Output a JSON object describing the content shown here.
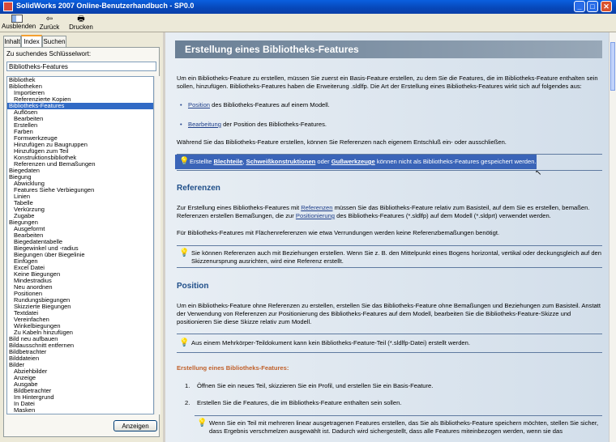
{
  "window": {
    "title": "SolidWorks 2007 Online-Benutzerhandbuch - SP0.0",
    "min": "_",
    "max": "□",
    "close": "✕"
  },
  "toolbar": {
    "hide": "Ausblenden",
    "back": "Zurück",
    "print": "Drucken"
  },
  "tabs": [
    "Inhalt",
    "Index",
    "Suchen"
  ],
  "index": {
    "label": "Zu suchendes Schlüsselwort:",
    "value": "Bibliotheks-Features",
    "items": [
      {
        "t": "Bibliothek",
        "l": 0
      },
      {
        "t": "Bibliotheken",
        "l": 0
      },
      {
        "t": "Importieren",
        "l": 1
      },
      {
        "t": "Referenzierte Kopien",
        "l": 1
      },
      {
        "t": "Bibliotheks-Features",
        "l": 0,
        "sel": true
      },
      {
        "t": "Auflösen",
        "l": 1
      },
      {
        "t": "Bearbeiten",
        "l": 1
      },
      {
        "t": "Erstellen",
        "l": 1
      },
      {
        "t": "Farben",
        "l": 1
      },
      {
        "t": "Formwerkzeuge",
        "l": 1
      },
      {
        "t": "Hinzufügen zu Baugruppen",
        "l": 1
      },
      {
        "t": "Hinzufügen zum Teil",
        "l": 1
      },
      {
        "t": "Konstruktionsbibliothek",
        "l": 1
      },
      {
        "t": "Referenzen und Bemaßungen",
        "l": 1
      },
      {
        "t": "Biegedaten",
        "l": 0
      },
      {
        "t": "Biegung",
        "l": 0
      },
      {
        "t": "Abwicklung",
        "l": 1
      },
      {
        "t": "Features Siehe Verbiegungen",
        "l": 1
      },
      {
        "t": "Linien",
        "l": 1
      },
      {
        "t": "Tabelle",
        "l": 1
      },
      {
        "t": "Verkürzung",
        "l": 1
      },
      {
        "t": "Zugabe",
        "l": 1
      },
      {
        "t": "Biegungen",
        "l": 0
      },
      {
        "t": "Ausgeformt",
        "l": 1
      },
      {
        "t": "Bearbeiten",
        "l": 1
      },
      {
        "t": "Biegedatentabelle",
        "l": 1
      },
      {
        "t": "Biegewinkel und -radius",
        "l": 1
      },
      {
        "t": "Biegungen über Biegelinie",
        "l": 1
      },
      {
        "t": "Einfügen",
        "l": 1
      },
      {
        "t": "Excel Datei",
        "l": 1
      },
      {
        "t": "Keine Biegungen",
        "l": 1
      },
      {
        "t": "Mindestradius",
        "l": 1
      },
      {
        "t": "Neu anordnen",
        "l": 1
      },
      {
        "t": "Positionen",
        "l": 1
      },
      {
        "t": "Rundungsbiegungen",
        "l": 1
      },
      {
        "t": "Skizzierte Biegungen",
        "l": 1
      },
      {
        "t": "Textdatei",
        "l": 1
      },
      {
        "t": "Vereinfachen",
        "l": 1
      },
      {
        "t": "Winkelbiegungen",
        "l": 1
      },
      {
        "t": "Zu Kabeln hinzufügen",
        "l": 1
      },
      {
        "t": "Bild neu aufbauen",
        "l": 0
      },
      {
        "t": "Bildausschnitt entfernen",
        "l": 0
      },
      {
        "t": "Bildbetrachter",
        "l": 0
      },
      {
        "t": "Bilddateien",
        "l": 0
      },
      {
        "t": "Bilder",
        "l": 0
      },
      {
        "t": "Abziehbilder",
        "l": 1
      },
      {
        "t": "Anzeige",
        "l": 1
      },
      {
        "t": "Ausgabe",
        "l": 1
      },
      {
        "t": "Bildbetrachter",
        "l": 1
      },
      {
        "t": "Im Hintergrund",
        "l": 1
      },
      {
        "t": "In Datei",
        "l": 1
      },
      {
        "t": "Masken",
        "l": 1
      }
    ],
    "show_button": "Anzeigen"
  },
  "doc": {
    "title": "Erstellung eines Bibliotheks-Features",
    "intro": "Um ein Bibliotheks-Feature zu erstellen, müssen Sie zuerst ein Basis-Feature erstellen, zu dem Sie die Features, die im Bibliotheks-Feature enthalten sein sollen, hinzufügen. Bibliotheks-Features haben die Erweiterung .sldlfp. Die Art der Erstellung eines Bibliotheks-Features wirkt sich auf folgendes aus:",
    "bullet1_link": "Position",
    "bullet1_rest": " des Bibliotheks-Features auf einem Modell.",
    "bullet2_link": "Bearbeitung",
    "bullet2_rest": " der Position des Bibliotheks-Features.",
    "while": "Während Sie das Bibliotheks-Feature erstellen, können Sie Referenzen nach eigenem Entschluß ein- oder ausschließen.",
    "hl_pre": "Erstellte ",
    "hl_l1": "Blechteile",
    "hl_s1": ", ",
    "hl_l2": "Schweißkonstruktionen",
    "hl_s2": " oder ",
    "hl_l3": "Gußwerkzeuge",
    "hl_post": " können nicht als Bibliotheks-Features gespeichert werden.",
    "h_ref": "Referenzen",
    "ref_p1_a": "Zur Erstellung eines Bibliotheks-Features mit ",
    "ref_p1_link": "Referenzen",
    "ref_p1_b": " müssen Sie das Bibliotheks-Feature relativ zum Basisteil, auf dem Sie es erstellen, bemaßen. Referenzen erstellen Bemaßungen, die zur ",
    "ref_p1_link2": "Positionierung",
    "ref_p1_c": " des Bibliotheks-Features (*.sldlfp) auf dem Modell (*.sldprt) verwendet werden.",
    "ref_p2": "Für Bibliotheks-Features mit Flächenreferenzen wie etwa Verrundungen werden keine Referenzbemaßungen benötigt.",
    "ref_note": "Sie können Referenzen auch mit Beziehungen erstellen. Wenn Sie z. B. den Mittelpunkt eines Bogens horizontal, vertikal oder deckungsgleich auf den Skizzenursprung ausrichten, wird eine Referenz erstellt.",
    "h_pos": "Position",
    "pos_p1": "Um ein Bibliotheks-Feature ohne Referenzen zu erstellen, erstellen Sie das Bibliotheks-Feature ohne Bemaßungen und Beziehungen zum Basisteil. Anstatt der Verwendung von Referenzen zur Positionierung des Bibliotheks-Features auf dem Modell, bearbeiten Sie die Bibliotheks-Feature-Skizze und positionieren Sie diese Skizze relativ zum Modell.",
    "pos_note": "Aus einem Mehrkörper-Teildokument kann kein Bibliotheks-Feature-Teil (*.sldlfp-Datei) erstellt werden.",
    "h_create": "Erstellung eines Bibliotheks-Features:",
    "step1_num": "1.",
    "step1": "Öffnen Sie ein neues Teil, skizzieren Sie ein Profil, und erstellen Sie ein Basis-Feature.",
    "step2_num": "2.",
    "step2": "Erstellen Sie die Features, die im Bibliotheks-Feature enthalten sein sollen.",
    "last_note": "Wenn Sie ein Teil mit mehreren linear ausgetragenen Features erstellen, das Sie als Bibliotheks-Feature speichern möchten, stellen Sie sicher, dass Ergebnis verschmelzen ausgewählt ist. Dadurch wird sichergestellt, dass alle Features miteinbezogen werden, wenn sie das"
  }
}
